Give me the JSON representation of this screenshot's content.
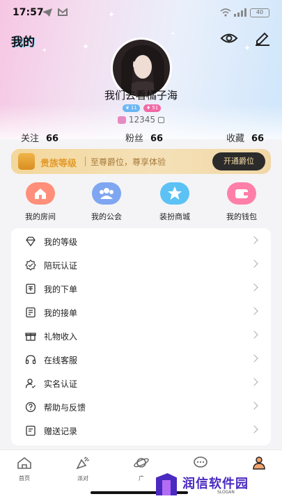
{
  "status_bar": {
    "time": "17:57",
    "battery": "40"
  },
  "header": {
    "title": "我的"
  },
  "profile": {
    "nickname": "我们去看橘子海",
    "badges": [
      {
        "text": "11"
      },
      {
        "text": "51"
      }
    ],
    "user_id": "12345"
  },
  "stats": [
    {
      "label": "关注",
      "value": "66"
    },
    {
      "label": "粉丝",
      "value": "66"
    },
    {
      "label": "收藏",
      "value": "66"
    }
  ],
  "vip": {
    "title": "贵族等级",
    "desc": "至尊爵位，尊享体验",
    "button": "开通爵位"
  },
  "quick_actions": [
    {
      "label": "我的房间",
      "icon": "house-icon",
      "color": "#ff8f7a"
    },
    {
      "label": "我的公会",
      "icon": "group-icon",
      "color": "#7fa6f0"
    },
    {
      "label": "装扮商城",
      "icon": "star-icon",
      "color": "#5cc2f6"
    },
    {
      "label": "我的钱包",
      "icon": "wallet-icon",
      "color": "#ff7fa8"
    }
  ],
  "menu": [
    {
      "label": "我的等级",
      "icon": "diamond-icon"
    },
    {
      "label": "陪玩认证",
      "icon": "verify-badge-icon"
    },
    {
      "label": "我的下单",
      "icon": "order-icon"
    },
    {
      "label": "我的接单",
      "icon": "receive-order-icon"
    },
    {
      "label": "礼物收入",
      "icon": "gift-icon"
    },
    {
      "label": "在线客服",
      "icon": "headset-icon"
    },
    {
      "label": "实名认证",
      "icon": "user-verify-icon"
    },
    {
      "label": "帮助与反馈",
      "icon": "help-icon"
    },
    {
      "label": "赠送记录",
      "icon": "record-icon"
    }
  ],
  "tabs": [
    {
      "label": "首页",
      "icon": "home-icon"
    },
    {
      "label": "派对",
      "icon": "party-icon"
    },
    {
      "label": "广",
      "icon": "planet-icon"
    },
    {
      "label": "",
      "icon": "chat-icon"
    },
    {
      "label": "",
      "icon": "profile-icon"
    }
  ],
  "watermark": {
    "text": "润信软件园",
    "slogan": "SLOGAN"
  }
}
